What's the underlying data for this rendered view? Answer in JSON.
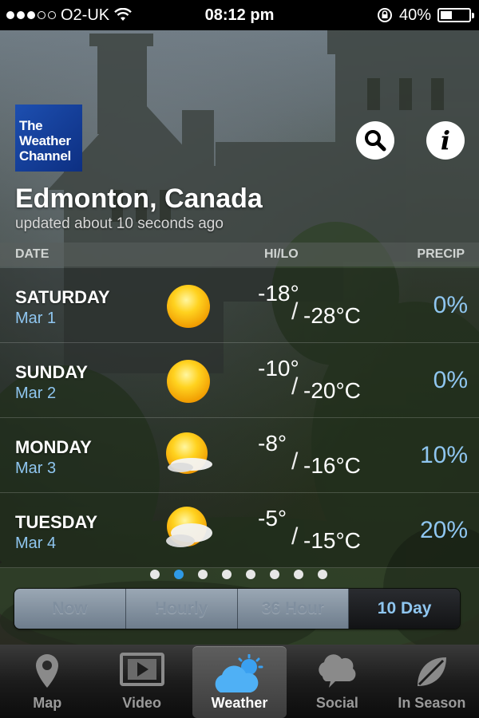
{
  "status_bar": {
    "carrier": "O2-UK",
    "time": "08:12 pm",
    "battery": "40%",
    "battery_level": 0.4
  },
  "header": {
    "logo_text": "The Weather Channel",
    "city": "Edmonton, Canada",
    "updated": "updated about 10 seconds ago"
  },
  "columns": {
    "date": "DATE",
    "hilo": "HI/LO",
    "precip": "PRECIP"
  },
  "days": [
    {
      "day": "SATURDAY",
      "date": "Mar 1",
      "hi": "-18°",
      "lo": "-28°C",
      "precip": "0%",
      "icon": "sun-icon"
    },
    {
      "day": "SUNDAY",
      "date": "Mar 2",
      "hi": "-10°",
      "lo": "-20°C",
      "precip": "0%",
      "icon": "sun-icon"
    },
    {
      "day": "MONDAY",
      "date": "Mar 3",
      "hi": "-8°",
      "lo": "-16°C",
      "precip": "10%",
      "icon": "sun-cloud-icon"
    },
    {
      "day": "TUESDAY",
      "date": "Mar 4",
      "hi": "-5°",
      "lo": "-15°C",
      "precip": "20%",
      "icon": "sun-cloud-icon"
    }
  ],
  "pagination": {
    "count": 8,
    "active_index": 1
  },
  "segments": {
    "items": [
      "Now",
      "Hourly",
      "36 Hour",
      "10 Day"
    ],
    "active": "10 Day"
  },
  "tabs": {
    "items": [
      {
        "label": "Map",
        "icon": "map-pin-icon"
      },
      {
        "label": "Video",
        "icon": "video-icon"
      },
      {
        "label": "Weather",
        "icon": "weather-icon"
      },
      {
        "label": "Social",
        "icon": "social-icon"
      },
      {
        "label": "In Season",
        "icon": "leaf-icon"
      }
    ],
    "active": "Weather"
  },
  "colors": {
    "accent_blue": "#8fc6f0",
    "logo_blue": "#1d4fb0",
    "dot_active": "#2f9ae6"
  }
}
